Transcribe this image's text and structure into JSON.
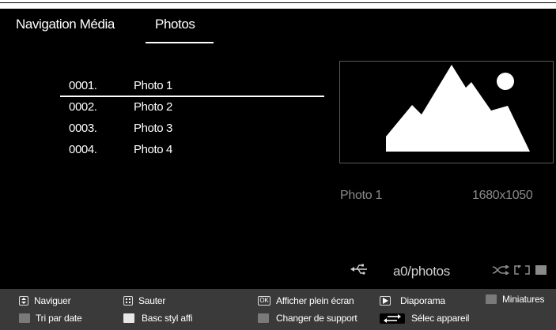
{
  "header": {
    "title": "Navigation Média",
    "active_tab": "Photos"
  },
  "file_list": [
    {
      "index": "0001.",
      "name": "Photo 1",
      "selected": true
    },
    {
      "index": "0002.",
      "name": "Photo 2",
      "selected": false
    },
    {
      "index": "0003.",
      "name": "Photo 3",
      "selected": false
    },
    {
      "index": "0004.",
      "name": "Photo 4",
      "selected": false
    }
  ],
  "preview": {
    "icon": "image-placeholder-icon"
  },
  "info": {
    "file_name": "Photo 1",
    "resolution": "1680x1050"
  },
  "status": {
    "source_icon": "usb-icon",
    "path": "a0/photos",
    "shuffle_icon": "shuffle-icon",
    "repeat_icon": "repeat-icon",
    "stop_icon": "stop-icon"
  },
  "footer": {
    "navigate": "Naviguer",
    "skip": "Sauter",
    "fullscreen": "Afficher plein écran",
    "fullscreen_key": "OK",
    "slideshow": "Diaporama",
    "thumbnails": "Miniatures",
    "sort_by_date": "Tri par date",
    "toggle_view_style": "Basc styl affi",
    "change_source": "Changer de support",
    "select_device": "Sélec appareil"
  },
  "colors": {
    "background": "#000000",
    "footer": "#3a3a3a",
    "dim_text": "#8a8a8a",
    "grey_button": "#7a7a7a",
    "white_button": "#e8e8e8"
  }
}
